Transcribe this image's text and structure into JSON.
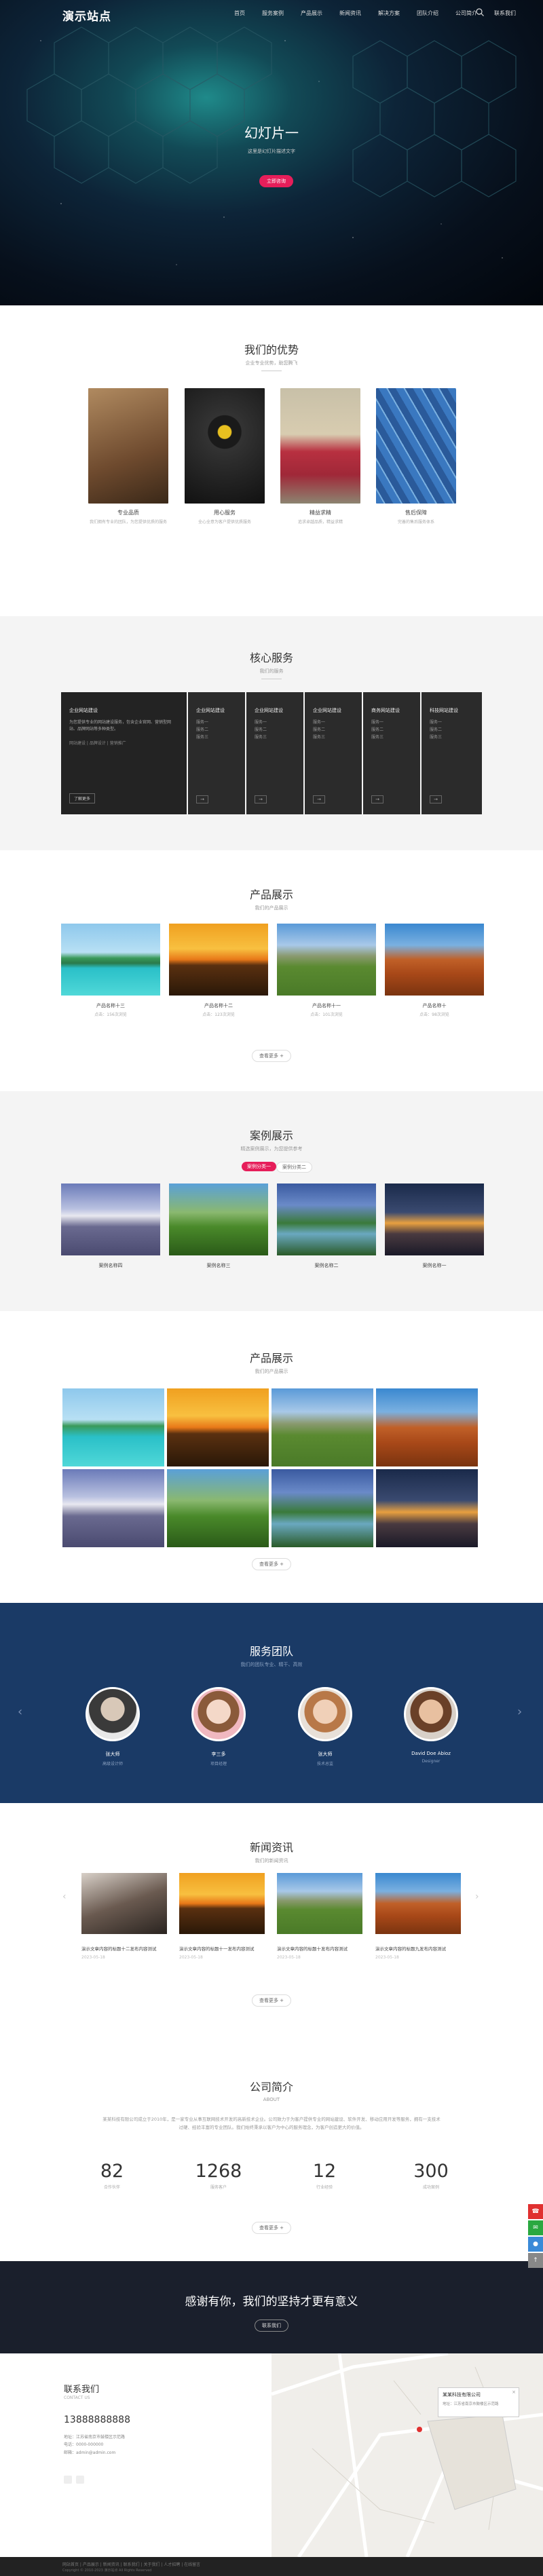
{
  "nav": {
    "logo": "演示站点",
    "items": [
      "首页",
      "服务案例",
      "产品展示",
      "新闻资讯",
      "解决方案",
      "团队介绍",
      "公司简介",
      "联系我们"
    ]
  },
  "hero": {
    "title": "幻灯片一",
    "subtitle": "这里是幻灯片描述文字",
    "button": "立即咨询"
  },
  "advantage": {
    "title": "我们的优势",
    "subtitle": "企业专业优势，助您腾飞",
    "items": [
      {
        "title": "专业品质",
        "desc": "我们拥有专业的团队，为您提供优质的服务"
      },
      {
        "title": "用心服务",
        "desc": "全心全意为客户提供优质服务"
      },
      {
        "title": "精益求精",
        "desc": "追求卓越品质，精益求精"
      },
      {
        "title": "售后保障",
        "desc": "完善的售后服务体系"
      }
    ]
  },
  "services": {
    "title": "核心服务",
    "subtitle": "我们的服务",
    "main": {
      "title": "企业网站建设",
      "desc": "为您提供专业的网站建设服务，包含企业官网、营销型网站、品牌网站等多种类型。",
      "links": [
        "网站建设",
        "品牌设计",
        "营销推广"
      ],
      "button": "了解更多"
    },
    "tabs": [
      {
        "title": "企业网站建设",
        "items": [
          "服务一",
          "服务二",
          "服务三"
        ]
      },
      {
        "title": "企业网站建设",
        "items": [
          "服务一",
          "服务二",
          "服务三"
        ]
      },
      {
        "title": "企业网站建设",
        "items": [
          "服务一",
          "服务二",
          "服务三"
        ]
      },
      {
        "title": "商务网站建设",
        "items": [
          "服务一",
          "服务二",
          "服务三"
        ]
      },
      {
        "title": "科技网站建设",
        "items": [
          "服务一",
          "服务二",
          "服务三"
        ]
      }
    ]
  },
  "products": {
    "title": "产品展示",
    "subtitle": "我们的产品展示",
    "items": [
      {
        "name": "产品名称十三",
        "price": "点击：156次浏览"
      },
      {
        "name": "产品名称十二",
        "price": "点击：123次浏览"
      },
      {
        "name": "产品名称十一",
        "price": "点击：101次浏览"
      },
      {
        "name": "产品名称十",
        "price": "点击：98次浏览"
      }
    ],
    "more": "查看更多 +"
  },
  "cases": {
    "title": "案例展示",
    "subtitle": "精选案例展示，为您提供参考",
    "tabs": [
      "案例分类一",
      "案例分类二"
    ],
    "items": [
      {
        "name": "案例名称四"
      },
      {
        "name": "案例名称三"
      },
      {
        "name": "案例名称二"
      },
      {
        "name": "案例名称一"
      }
    ]
  },
  "gallery": {
    "title": "产品展示",
    "subtitle": "我们的产品展示",
    "more": "查看更多 +"
  },
  "team": {
    "title": "服务团队",
    "subtitle": "我们的团队专业、精干、高效",
    "members": [
      {
        "name": "张大师",
        "role": "高级设计师"
      },
      {
        "name": "李三多",
        "role": "项目经理"
      },
      {
        "name": "张大师",
        "role": "技术总监"
      },
      {
        "name": "David Doe Abioz",
        "role": "Designer"
      }
    ]
  },
  "news": {
    "title": "新闻资讯",
    "subtitle": "我们的新闻资讯",
    "items": [
      {
        "title": "演示文章内容的标题十二发布内容测试",
        "date": "2023-05-18"
      },
      {
        "title": "演示文章内容的标题十一发布内容测试",
        "date": "2023-05-18"
      },
      {
        "title": "演示文章内容的标题十发布内容测试",
        "date": "2023-05-18"
      },
      {
        "title": "演示文章内容的标题九发布内容测试",
        "date": "2023-05-18"
      }
    ],
    "more": "查看更多 +"
  },
  "about": {
    "title": "公司简介",
    "subtitle": "ABOUT",
    "text": "某某科技有限公司成立于2010年，是一家专业从事互联网技术开发的高新技术企业。公司致力于为客户提供专业的网站建设、软件开发、移动应用开发等服务，拥有一支技术过硬、经验丰富的专业团队。我们始终秉承以客户为中心的服务理念，为客户创造更大的价值。",
    "stats": [
      {
        "num": "82",
        "unit": "合作伙伴"
      },
      {
        "num": "1268",
        "unit": "服务客户"
      },
      {
        "num": "12",
        "unit": "行业经验"
      },
      {
        "num": "300",
        "unit": "成功案例"
      }
    ],
    "more": "查看更多 +"
  },
  "thanks": {
    "title": "感谢有你，我们的坚持才更有意义",
    "button": "联系我们"
  },
  "contact": {
    "title": "联系我们",
    "subtitle": "CONTACT US",
    "phone": "13888888888",
    "lines": [
      "地址：江苏省南京市鼓楼区示范路",
      "电话：0000-000000",
      "邮箱：admin@admin.com"
    ],
    "map_label": "某某科技有限公司",
    "map_addr": "地址：江苏省南京市鼓楼区示范路"
  },
  "footer": {
    "links": [
      "网站首页",
      "产品展示",
      "新闻资讯",
      "联系我们",
      "关于我们",
      "人才招聘",
      "在线留言"
    ],
    "copyright": "Copyright © 2010-2023 演示站点 All Rights Reserved"
  }
}
